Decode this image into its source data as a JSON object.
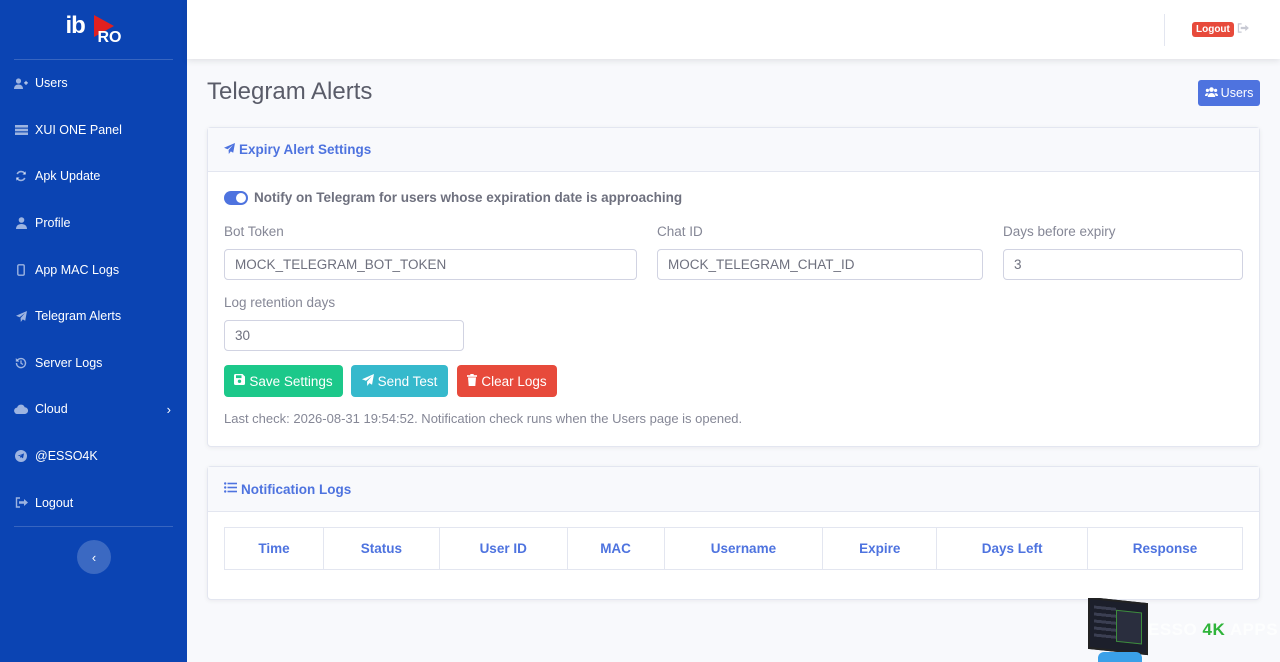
{
  "sidebar": {
    "brand": {
      "logo_text_left": "ib",
      "logo_text_right": "RO"
    },
    "items": [
      {
        "label": "Users",
        "icon": "user-plus-icon"
      },
      {
        "label": "XUI ONE Panel",
        "icon": "server-icon"
      },
      {
        "label": "Apk Update",
        "icon": "refresh-icon"
      },
      {
        "label": "Profile",
        "icon": "user-icon"
      },
      {
        "label": "App MAC Logs",
        "icon": "mobile-icon"
      },
      {
        "label": "Telegram Alerts",
        "icon": "paper-plane-icon"
      },
      {
        "label": "Server Logs",
        "icon": "history-icon"
      },
      {
        "label": "Cloud",
        "icon": "cloud-icon"
      },
      {
        "label": "@ESSO4K",
        "icon": "telegram-icon"
      },
      {
        "label": "Logout",
        "icon": "sign-out-icon"
      }
    ]
  },
  "topbar": {
    "logout_badge": "Logout"
  },
  "page": {
    "title": "Telegram Alerts",
    "users_button": "Users"
  },
  "settings_card": {
    "title": "Expiry Alert Settings",
    "toggle_label": "Notify on Telegram for users whose expiration date is approaching",
    "toggle_on": true,
    "bot_token_label": "Bot Token",
    "bot_token_value": "MOCK_TELEGRAM_BOT_TOKEN",
    "chat_id_label": "Chat ID",
    "chat_id_value": "MOCK_TELEGRAM_CHAT_ID",
    "days_label": "Days before expiry",
    "days_value": "3",
    "retention_label": "Log retention days",
    "retention_value": "30",
    "save_label": "Save Settings",
    "test_label": "Send Test",
    "clear_label": "Clear Logs",
    "last_check": "Last check: 2026-08-31 19:54:52. Notification check runs when the Users page is opened."
  },
  "logs_card": {
    "title": "Notification Logs",
    "columns": [
      "Time",
      "Status",
      "User ID",
      "MAC",
      "Username",
      "Expire",
      "Days Left",
      "Response"
    ]
  },
  "watermark": {
    "part1": "ESSO",
    "part2": "4K",
    "part3": "APPS"
  },
  "colors": {
    "primary": "#4e73df",
    "sidebar": "#0b44b3",
    "success": "#1cc88a",
    "info": "#36b9cc",
    "danger": "#e74a3b"
  }
}
